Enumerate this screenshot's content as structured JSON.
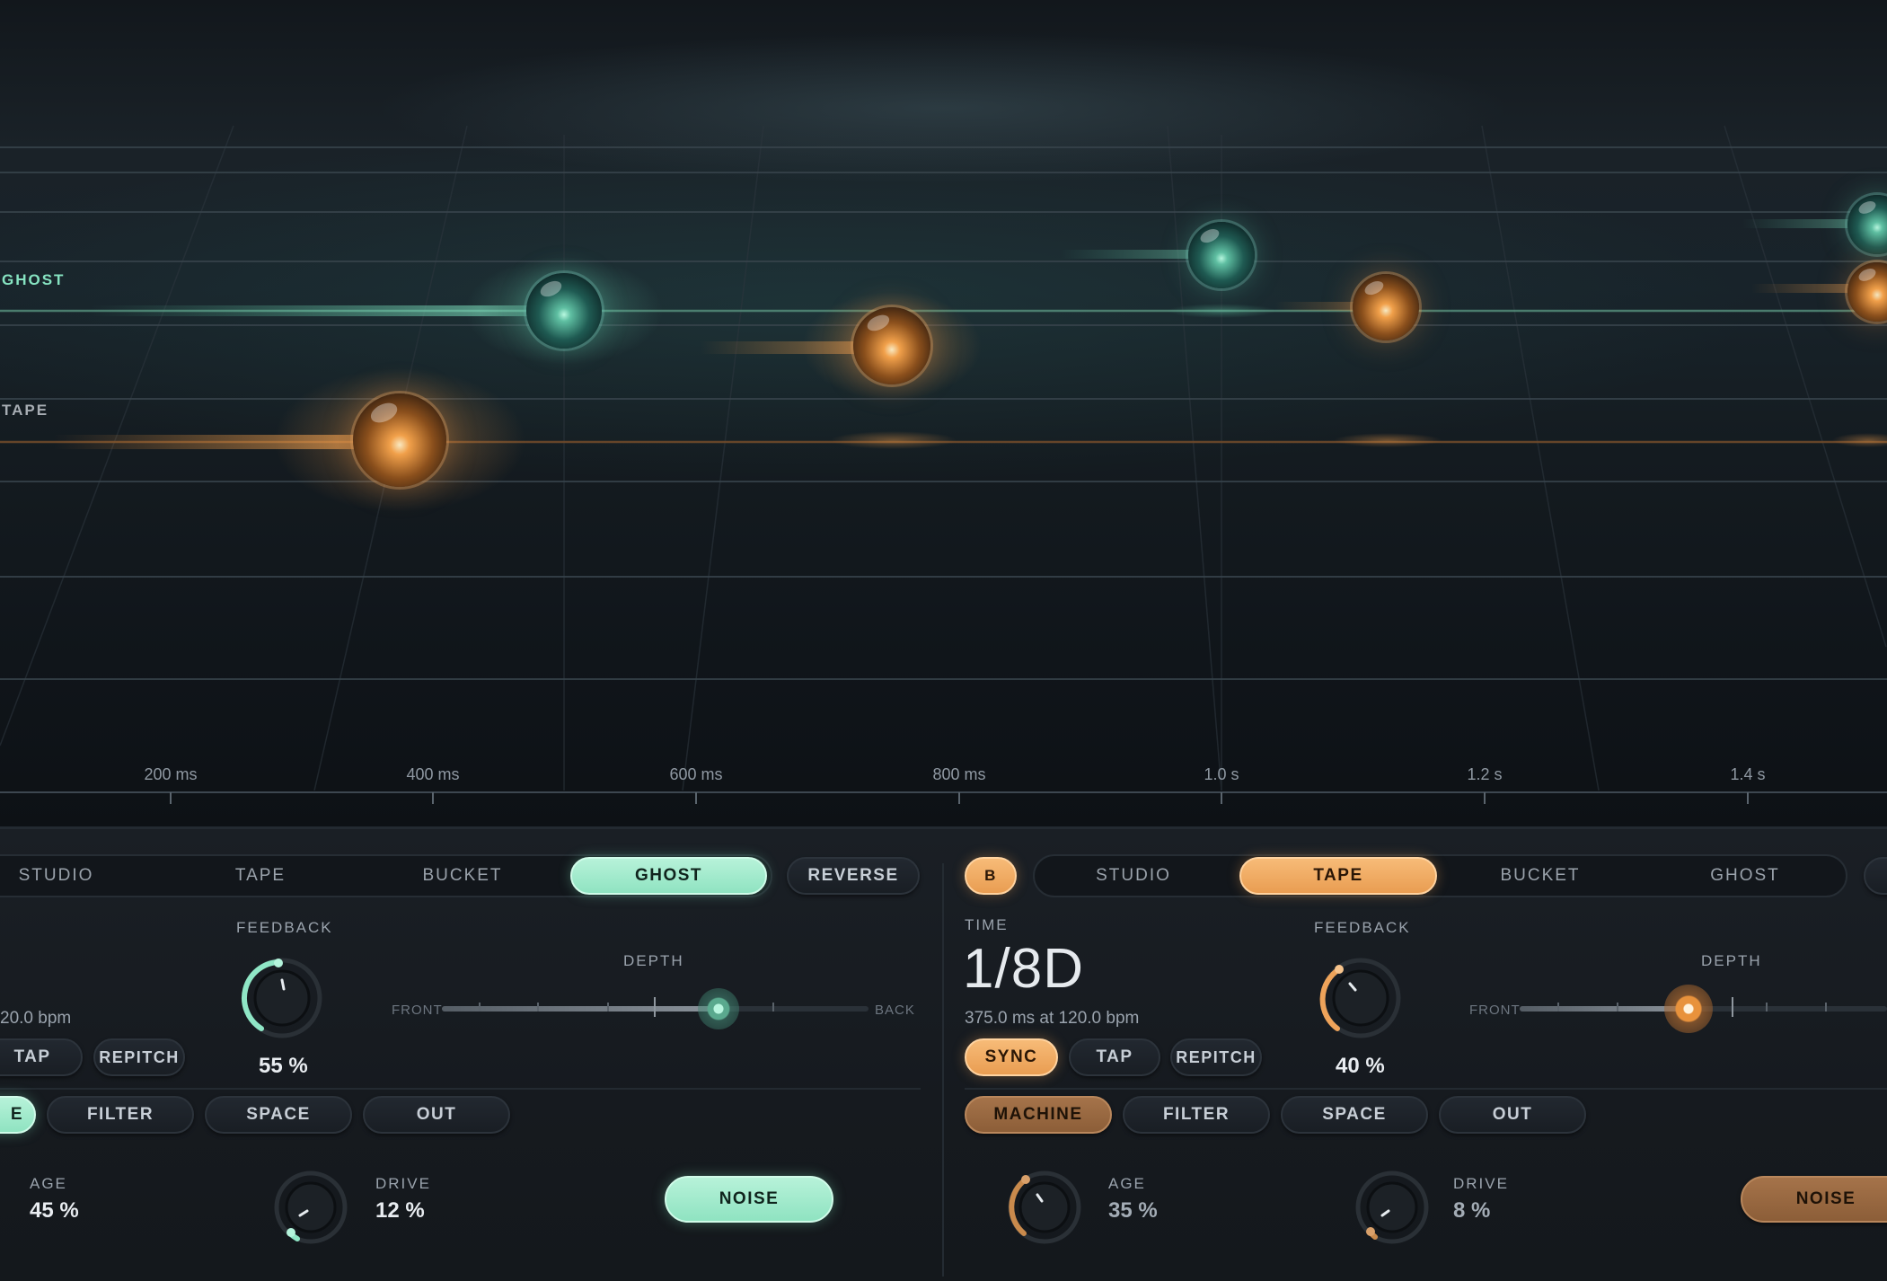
{
  "visualizer": {
    "lanes": [
      {
        "label": "GHOST",
        "color": "#86e3c1"
      },
      {
        "label": "TAPE",
        "color": "#a7adb3"
      }
    ],
    "time_axis": [
      "200 ms",
      "400 ms",
      "600 ms",
      "800 ms",
      "1.0 s",
      "1.2 s",
      "1.4 s"
    ],
    "accent_teal": "#86e3c1",
    "accent_amber": "#f0a55a"
  },
  "deck_a": {
    "type_tabs": [
      "STUDIO",
      "TAPE",
      "BUCKET",
      "GHOST"
    ],
    "active_type": "GHOST",
    "reverse_label": "REVERSE",
    "bpm_text": "20.0 bpm",
    "tap_label": "TAP",
    "repitch_label": "REPITCH",
    "feedback": {
      "label": "FEEDBACK",
      "value": "55 %",
      "level": 0.55
    },
    "depth": {
      "label": "DEPTH",
      "front": "FRONT",
      "back": "BACK",
      "level": 0.65
    },
    "section_tabs": [
      "E",
      "FILTER",
      "SPACE",
      "OUT"
    ],
    "age": {
      "label": "AGE",
      "value": "45 %"
    },
    "drive": {
      "label": "DRIVE",
      "value": "12 %",
      "level": 0.12
    },
    "noise_label": "NOISE"
  },
  "deck_b": {
    "badge": "B",
    "type_tabs": [
      "STUDIO",
      "TAPE",
      "BUCKET",
      "GHOST"
    ],
    "active_type": "TAPE",
    "time": {
      "label": "TIME",
      "value": "1/8D",
      "detail": "375.0 ms at 120.0 bpm"
    },
    "sync_label": "SYNC",
    "tap_label": "TAP",
    "repitch_label": "REPITCH",
    "feedback": {
      "label": "FEEDBACK",
      "value": "40 %",
      "level": 0.4
    },
    "depth": {
      "label": "DEPTH",
      "front": "FRONT",
      "level": 0.42
    },
    "section_tabs": [
      "MACHINE",
      "FILTER",
      "SPACE",
      "OUT"
    ],
    "active_section": "MACHINE",
    "age": {
      "label": "AGE",
      "value": "35 %",
      "level": 0.35
    },
    "drive": {
      "label": "DRIVE",
      "value": "8 %",
      "level": 0.08
    },
    "noise_label": "NOISE"
  }
}
